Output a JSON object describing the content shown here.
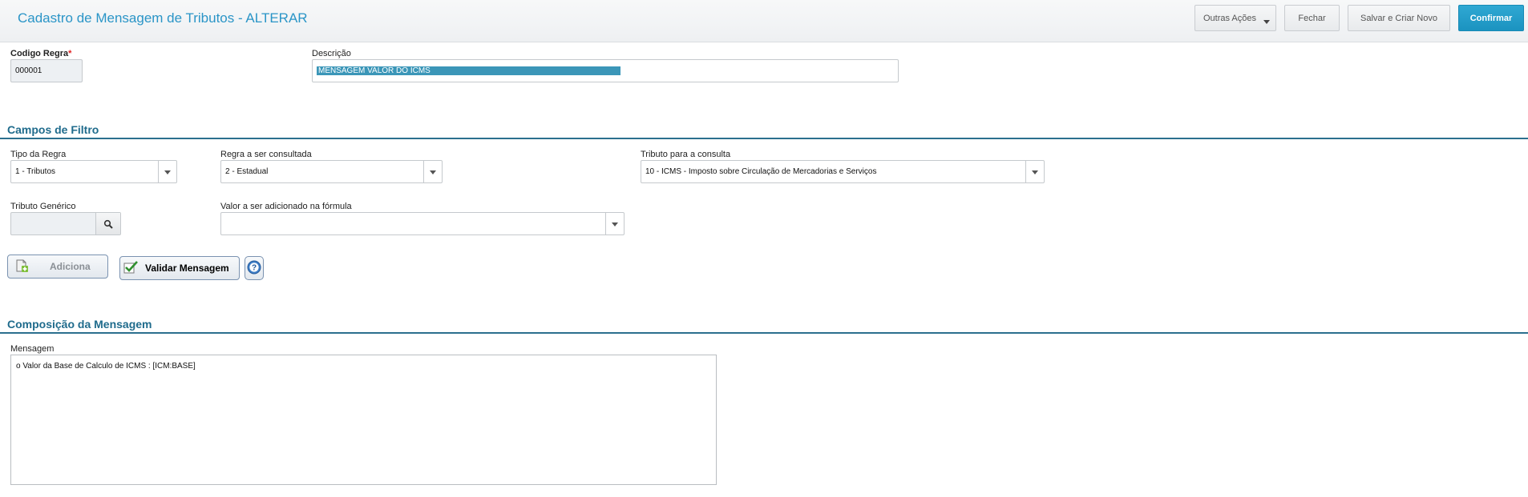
{
  "header": {
    "title": "Cadastro de Mensagem de Tributos - ALTERAR",
    "buttons": {
      "other_actions": "Outras Ações",
      "close": "Fechar",
      "save_new": "Salvar e Criar Novo",
      "confirm": "Confirmar"
    }
  },
  "fields": {
    "rule_code": {
      "label": "Codigo Regra",
      "required_mark": "*",
      "value": "000001"
    },
    "description": {
      "label": "Descrição",
      "value": "MENSAGEM VALOR DO ICMS"
    }
  },
  "filter_section": {
    "title": "Campos de Filtro",
    "rule_type": {
      "label": "Tipo da Regra",
      "value": "1 - Tributos"
    },
    "rule_query": {
      "label": "Regra a ser consultada",
      "value": "2 - Estadual"
    },
    "tax_query": {
      "label": "Tributo para a consulta",
      "value": "10 - ICMS - Imposto sobre Circulação de Mercadorias e Serviços"
    },
    "generic_tax": {
      "label": "Tributo Genérico",
      "value": ""
    },
    "formula_value": {
      "label": "Valor a ser adicionado na fórmula",
      "value": ""
    }
  },
  "actions": {
    "add": "Adiciona",
    "validate": "Validar Mensagem"
  },
  "composition_section": {
    "title": "Composição da Mensagem",
    "message_label": "Mensagem",
    "message_value": "o Valor da Base de Calculo de ICMS : [ICM:BASE]"
  },
  "colors": {
    "accent": "#2a95c7",
    "confirm_button": "#1b93c0",
    "section_title": "#1f6b8c",
    "selection_highlight": "#3b96b8"
  }
}
